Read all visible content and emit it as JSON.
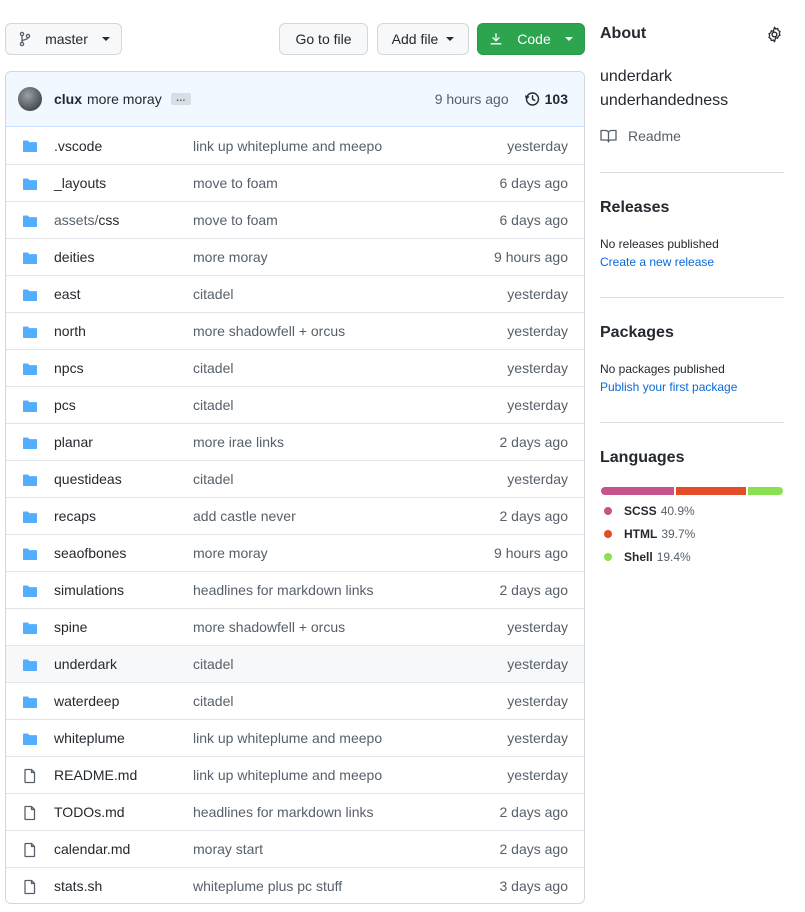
{
  "toolbar": {
    "branch": "master",
    "go_to_file": "Go to file",
    "add_file": "Add file",
    "code": "Code"
  },
  "commit": {
    "author": "clux",
    "message": "more moray",
    "ellipsis": "…",
    "time": "9 hours ago",
    "count": "103"
  },
  "files": [
    {
      "type": "dir",
      "name": ".vscode",
      "msg": "link up whiteplume and meepo",
      "age": "yesterday"
    },
    {
      "type": "dir",
      "name": "_layouts",
      "msg": "move to foam",
      "age": "6 days ago"
    },
    {
      "type": "dir",
      "prefix": "assets/",
      "name": "css",
      "msg": "move to foam",
      "age": "6 days ago"
    },
    {
      "type": "dir",
      "name": "deities",
      "msg": "more moray",
      "age": "9 hours ago"
    },
    {
      "type": "dir",
      "name": "east",
      "msg": "citadel",
      "age": "yesterday"
    },
    {
      "type": "dir",
      "name": "north",
      "msg": "more shadowfell + orcus",
      "age": "yesterday"
    },
    {
      "type": "dir",
      "name": "npcs",
      "msg": "citadel",
      "age": "yesterday"
    },
    {
      "type": "dir",
      "name": "pcs",
      "msg": "citadel",
      "age": "yesterday"
    },
    {
      "type": "dir",
      "name": "planar",
      "msg": "more irae links",
      "age": "2 days ago"
    },
    {
      "type": "dir",
      "name": "questideas",
      "msg": "citadel",
      "age": "yesterday"
    },
    {
      "type": "dir",
      "name": "recaps",
      "msg": "add castle never",
      "age": "2 days ago"
    },
    {
      "type": "dir",
      "name": "seaofbones",
      "msg": "more moray",
      "age": "9 hours ago"
    },
    {
      "type": "dir",
      "name": "simulations",
      "msg": "headlines for markdown links",
      "age": "2 days ago"
    },
    {
      "type": "dir",
      "name": "spine",
      "msg": "more shadowfell + orcus",
      "age": "yesterday"
    },
    {
      "type": "dir",
      "name": "underdark",
      "msg": "citadel",
      "age": "yesterday",
      "highlight": true
    },
    {
      "type": "dir",
      "name": "waterdeep",
      "msg": "citadel",
      "age": "yesterday"
    },
    {
      "type": "dir",
      "name": "whiteplume",
      "msg": "link up whiteplume and meepo",
      "age": "yesterday"
    },
    {
      "type": "file",
      "name": "README.md",
      "msg": "link up whiteplume and meepo",
      "age": "yesterday"
    },
    {
      "type": "file",
      "name": "TODOs.md",
      "msg": "headlines for markdown links",
      "age": "2 days ago"
    },
    {
      "type": "file",
      "name": "calendar.md",
      "msg": "moray start",
      "age": "2 days ago"
    },
    {
      "type": "file",
      "name": "stats.sh",
      "msg": "whiteplume plus pc stuff",
      "age": "3 days ago"
    }
  ],
  "about": {
    "title": "About",
    "description_line1": "underdark",
    "description_line2": "underhandedness",
    "readme": "Readme"
  },
  "releases": {
    "title": "Releases",
    "status": "No releases published",
    "link": "Create a new release"
  },
  "packages": {
    "title": "Packages",
    "status": "No packages published",
    "link": "Publish your first package"
  },
  "languages": {
    "title": "Languages",
    "items": [
      {
        "name": "SCSS",
        "pct": "40.9%",
        "value": 40.9,
        "color": "#c6538c"
      },
      {
        "name": "HTML",
        "pct": "39.7%",
        "value": 39.7,
        "color": "#e34c26"
      },
      {
        "name": "Shell",
        "pct": "19.4%",
        "value": 19.4,
        "color": "#89e051"
      }
    ]
  },
  "colors": {
    "folder": "#54aeff",
    "file": "#57606a",
    "link": "#0969da",
    "primary": "#2da44e"
  }
}
